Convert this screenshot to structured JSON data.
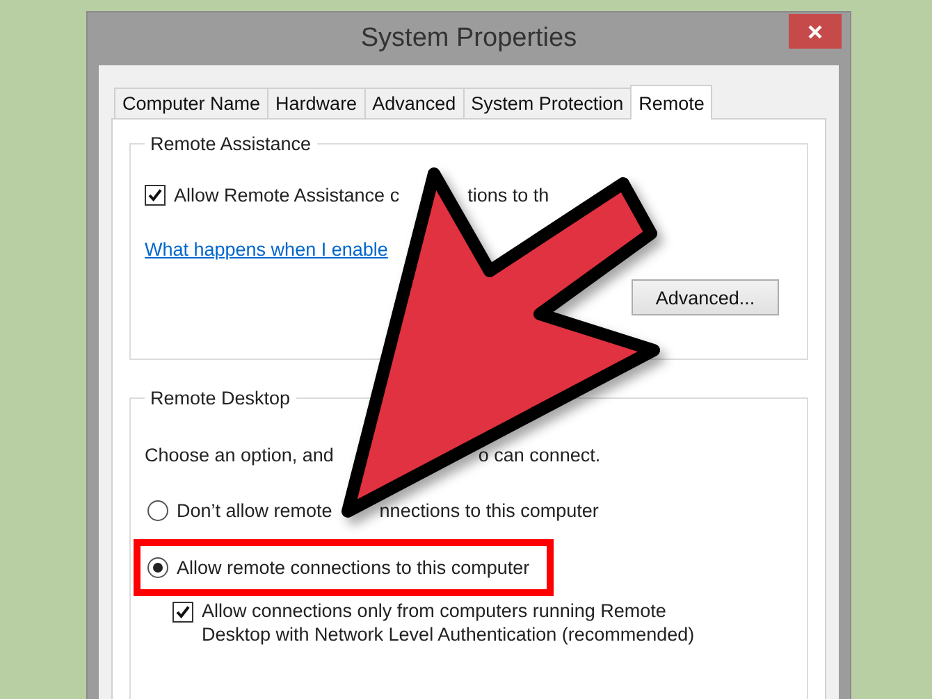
{
  "window": {
    "title": "System Properties"
  },
  "tabs": [
    {
      "label": "Computer Name",
      "selected": false
    },
    {
      "label": "Hardware",
      "selected": false
    },
    {
      "label": "Advanced",
      "selected": false
    },
    {
      "label": "System Protection",
      "selected": false
    },
    {
      "label": "Remote",
      "selected": true
    }
  ],
  "remote_assistance": {
    "heading": "Remote Assistance",
    "allow": {
      "label_parts": [
        "Allow Remote Assistance c",
        "tions to th"
      ],
      "checked": true
    },
    "link": "What happens when I enable",
    "advanced_button": "Advanced..."
  },
  "remote_desktop": {
    "heading": "Remote Desktop",
    "intro_parts": [
      "Choose an option, and",
      "o can connect."
    ],
    "options": [
      {
        "label_parts": [
          "Don’t allow remote",
          "nnections to this computer"
        ],
        "selected": false,
        "highlighted": false
      },
      {
        "label_parts": [
          "Allow remote connections to this computer"
        ],
        "selected": true,
        "highlighted": true
      }
    ],
    "nla": {
      "label": "Allow connections only from computers running Remote Desktop with Network Level Authentication (recommended)",
      "checked": true
    }
  }
}
